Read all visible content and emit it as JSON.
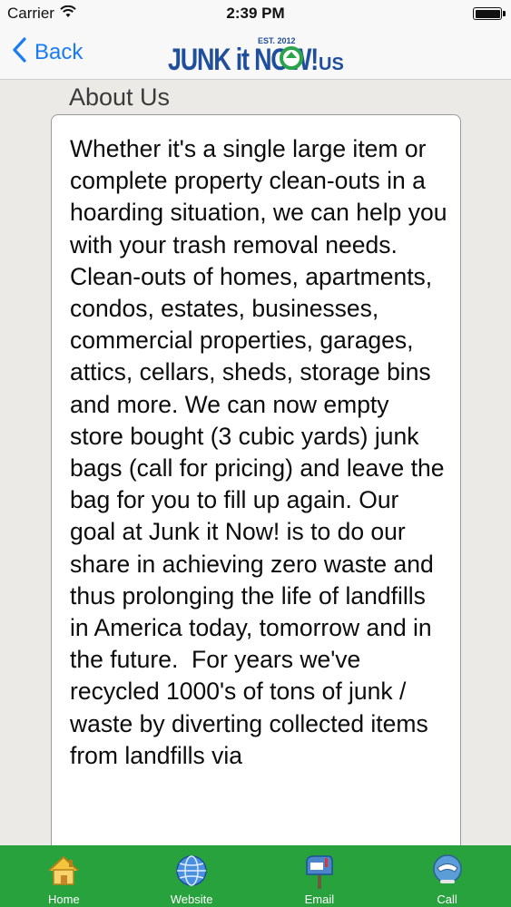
{
  "status_bar": {
    "carrier": "Carrier",
    "time": "2:39 PM"
  },
  "nav": {
    "back_label": "Back",
    "logo_text": "JUNK it NOW!",
    "logo_suffix": "US",
    "logo_est": "EST. 2012"
  },
  "about": {
    "title": "About Us",
    "body": "Whether it's a single large item or complete property clean-outs in a hoarding situation, we can help you with your trash removal needs.  Clean-outs of homes, apartments, condos, estates, businesses, commercial properties, garages, attics, cellars, sheds, storage bins and more. We can now empty store bought (3 cubic yards) junk bags (call for pricing) and leave the bag for you to fill up again. Our goal at Junk it Now! is to do our share in achieving zero waste and thus prolonging the life of landfills in America today, tomorrow and in the future.  For years we've recycled 1000's of tons of junk / waste by diverting collected items from landfills via"
  },
  "tabs": [
    {
      "label": "Home",
      "icon": "house-icon"
    },
    {
      "label": "Website",
      "icon": "globe-icon"
    },
    {
      "label": "Email",
      "icon": "mailbox-icon"
    },
    {
      "label": "Call",
      "icon": "phone-icon"
    }
  ],
  "colors": {
    "accent": "#1a7cf5",
    "tab_bar": "#27a23d",
    "logo_blue": "#1f4e9c",
    "logo_green": "#2aa44a"
  }
}
